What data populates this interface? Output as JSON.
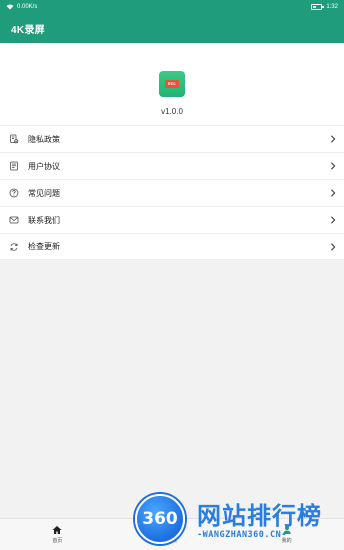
{
  "status_bar": {
    "network_speed": "0.00K/s",
    "time": "1:32"
  },
  "app_bar": {
    "title": "4K录屏"
  },
  "about": {
    "icon_text": "REC",
    "version": "v1.0.0"
  },
  "menu": {
    "items": [
      {
        "label": "隐私政策",
        "icon": "privacy-policy-icon"
      },
      {
        "label": "用户协议",
        "icon": "user-agreement-icon"
      },
      {
        "label": "常见问题",
        "icon": "help-icon"
      },
      {
        "label": "联系我们",
        "icon": "mail-icon"
      },
      {
        "label": "检查更新",
        "icon": "refresh-icon"
      }
    ]
  },
  "bottom_nav": {
    "tabs": [
      {
        "label": "首页",
        "icon": "home-icon"
      },
      {
        "label": "视频",
        "icon": "video-icon"
      },
      {
        "label": "我的",
        "icon": "person-icon"
      }
    ]
  },
  "watermark": {
    "logo_text": "360",
    "brand_text": "网站排行榜",
    "sub_text": "-WANGZHAN360.CN-"
  },
  "colors": {
    "primary": "#1f9c7c",
    "watermark_blue": "#2a7de1"
  }
}
